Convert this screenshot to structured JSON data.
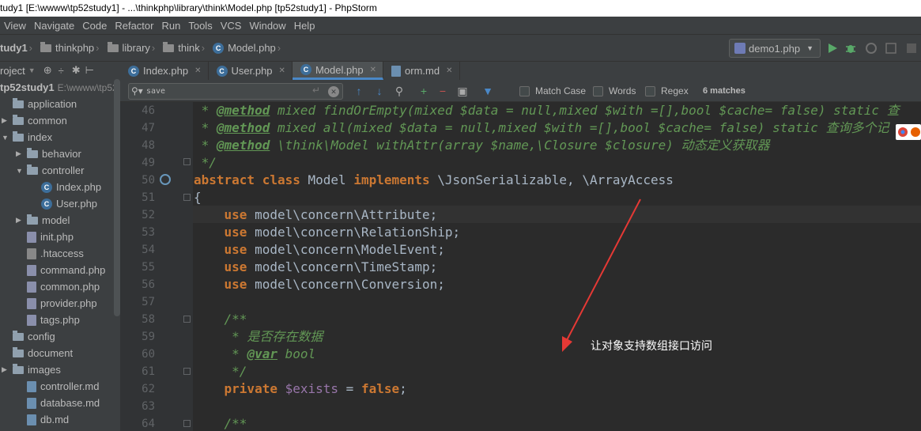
{
  "title": "tudy1 [E:\\wwww\\tp52study1] - ...\\thinkphp\\library\\think\\Model.php [tp52study1] - PhpStorm",
  "menu": [
    "View",
    "Navigate",
    "Code",
    "Refactor",
    "Run",
    "Tools",
    "VCS",
    "Window",
    "Help"
  ],
  "breadcrumbs": [
    "tudy1",
    "thinkphp",
    "library",
    "think",
    "Model.php"
  ],
  "run_config": "demo1.php",
  "project_header": "roject",
  "project_root": "tp52study1",
  "project_root_path": "E:\\wwww\\tp52",
  "tree": [
    {
      "label": "application",
      "kind": "folder",
      "arrow": ""
    },
    {
      "label": "common",
      "kind": "folder",
      "arrow": "▶"
    },
    {
      "label": "index",
      "kind": "folder",
      "arrow": "▼"
    },
    {
      "label": "behavior",
      "kind": "folder",
      "arrow": "▶"
    },
    {
      "label": "controller",
      "kind": "folder",
      "arrow": "▼"
    },
    {
      "label": "Index.php",
      "kind": "class"
    },
    {
      "label": "User.php",
      "kind": "class"
    },
    {
      "label": "model",
      "kind": "folder",
      "arrow": "▶"
    },
    {
      "label": "init.php",
      "kind": "php"
    },
    {
      "label": ".htaccess",
      "kind": "ht"
    },
    {
      "label": "command.php",
      "kind": "php"
    },
    {
      "label": "common.php",
      "kind": "php"
    },
    {
      "label": "provider.php",
      "kind": "php"
    },
    {
      "label": "tags.php",
      "kind": "php"
    },
    {
      "label": "config",
      "kind": "folder",
      "arrow": ""
    },
    {
      "label": "document",
      "kind": "folder",
      "arrow": ""
    },
    {
      "label": "images",
      "kind": "folder",
      "arrow": "▶"
    },
    {
      "label": "controller.md",
      "kind": "md"
    },
    {
      "label": "database.md",
      "kind": "md"
    },
    {
      "label": "db.md",
      "kind": "md"
    }
  ],
  "tabs": [
    "Index.php",
    "User.php",
    "Model.php",
    "orm.md"
  ],
  "active_tab": "Model.php",
  "search": {
    "value": "save",
    "match_case": "Match Case",
    "words": "Words",
    "regex": "Regex",
    "matches": "6 matches"
  },
  "line_numbers": [
    "46",
    "47",
    "48",
    "49",
    "50",
    "51",
    "52",
    "53",
    "54",
    "55",
    "56",
    "57",
    "58",
    "59",
    "60",
    "61",
    "62",
    "63",
    "64"
  ],
  "code": {
    "l46_tag": "@method",
    "l46_rest": " mixed findOrEmpty(mixed $data = null,mixed $with =[],bool $cache= false) static 查",
    "l47_tag": "@method",
    "l47_rest": " mixed all(mixed $data = null,mixed $with =[],bool $cache= false) static 查询多个记",
    "l48_tag": "@method",
    "l48_rest": " \\think\\Model withAttr(array $name,\\Closure $closure) 动态定义获取器",
    "l49": " */",
    "l50_kw1": "abstract",
    "l50_kw2": "class",
    "l50_name": "Model",
    "l50_kw3": "implements",
    "l50_rest": " \\JsonSerializable, \\ArrayAccess",
    "l51": "{",
    "use_kw": "use",
    "l52": " model\\concern\\Attribute;",
    "l53": " model\\concern\\RelationShip;",
    "l54": " model\\concern\\ModelEvent;",
    "l55": " model\\concern\\TimeStamp;",
    "l56": " model\\concern\\Conversion;",
    "l58": "/**",
    "l59": " * 是否存在数据",
    "l60_tag": "@var",
    "l60_rest": " bool",
    "l61": " */",
    "l62_kw": "private",
    "l62_var": "$exists",
    "l62_eq": " = ",
    "l62_val": "false",
    "l62_end": ";",
    "l64": "/**"
  },
  "annotation": "让对象支持数组接口访问"
}
